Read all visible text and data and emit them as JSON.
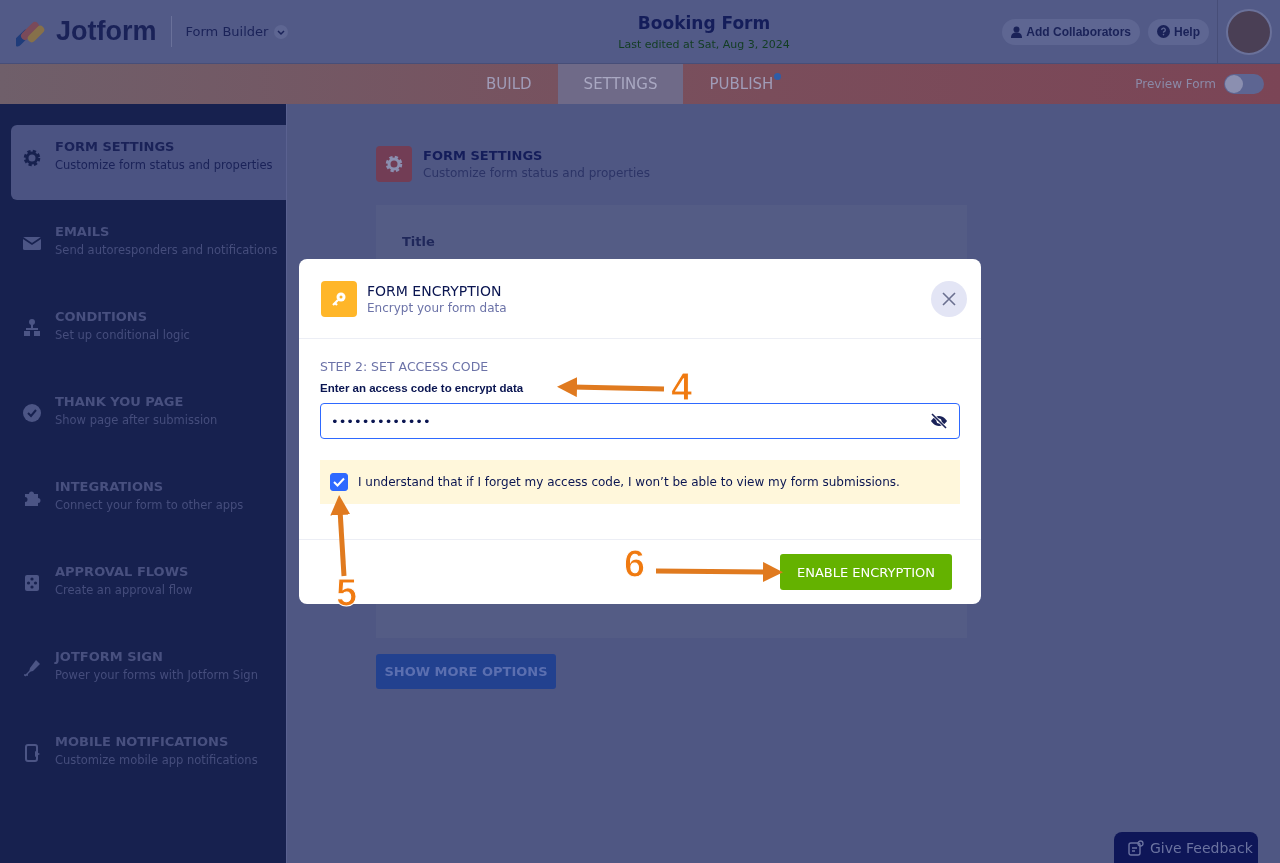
{
  "header": {
    "brand": "Jotform",
    "builder_menu": "Form Builder",
    "title": "Booking Form",
    "subtitle": "Last edited at Sat, Aug 3, 2024",
    "buttons": [
      {
        "label": "Add Collaborators",
        "kind": "person"
      },
      {
        "label": "Help",
        "kind": "help"
      }
    ]
  },
  "tabs": [
    {
      "label": "BUILD",
      "selected": false,
      "badge": false
    },
    {
      "label": "SETTINGS",
      "selected": true,
      "badge": false
    },
    {
      "label": "PUBLISH",
      "selected": false,
      "badge": true
    }
  ],
  "preview": {
    "label": "Preview Form",
    "on": false
  },
  "sidebar": {
    "items": [
      {
        "kind": "gear",
        "title": "FORM SETTINGS",
        "subtitle": "Customize form status and properties",
        "selected": true
      },
      {
        "kind": "mail",
        "title": "EMAILS",
        "subtitle": "Send autoresponders and notifications",
        "selected": false
      },
      {
        "kind": "tree",
        "title": "CONDITIONS",
        "subtitle": "Set up conditional logic",
        "selected": false
      },
      {
        "kind": "check",
        "title": "THANK YOU PAGE",
        "subtitle": "Show page after submission",
        "selected": false
      },
      {
        "kind": "puzzle",
        "title": "INTEGRATIONS",
        "subtitle": "Connect your form to other apps",
        "selected": false
      },
      {
        "kind": "flow",
        "title": "APPROVAL FLOWS",
        "subtitle": "Create an approval flow",
        "selected": false
      },
      {
        "kind": "pen",
        "title": "JOTFORM SIGN",
        "subtitle": "Power your forms with Jotform Sign",
        "selected": false
      },
      {
        "kind": "phone",
        "title": "MOBILE NOTIFICATIONS",
        "subtitle": "Customize mobile app notifications",
        "selected": false
      }
    ]
  },
  "main": {
    "title": "FORM SETTINGS",
    "subtitle": "Customize form status and properties",
    "field_label": "Title",
    "more_button": "SHOW MORE OPTIONS"
  },
  "modal": {
    "title": "FORM ENCRYPTION",
    "subtitle": "Encrypt your form data",
    "step": "STEP 2: SET ACCESS CODE",
    "field_label": "Enter an access code to encrypt data",
    "value": "•••••••••••••",
    "consent": {
      "text": "I understand that if I forget my access code, I won’t be able to view my form submissions.",
      "checked": true
    },
    "submit": "ENABLE ENCRYPTION"
  },
  "annotations": [
    {
      "label": "4"
    },
    {
      "label": "5"
    },
    {
      "label": "6"
    }
  ],
  "feedback_button": "Give Feedback"
}
